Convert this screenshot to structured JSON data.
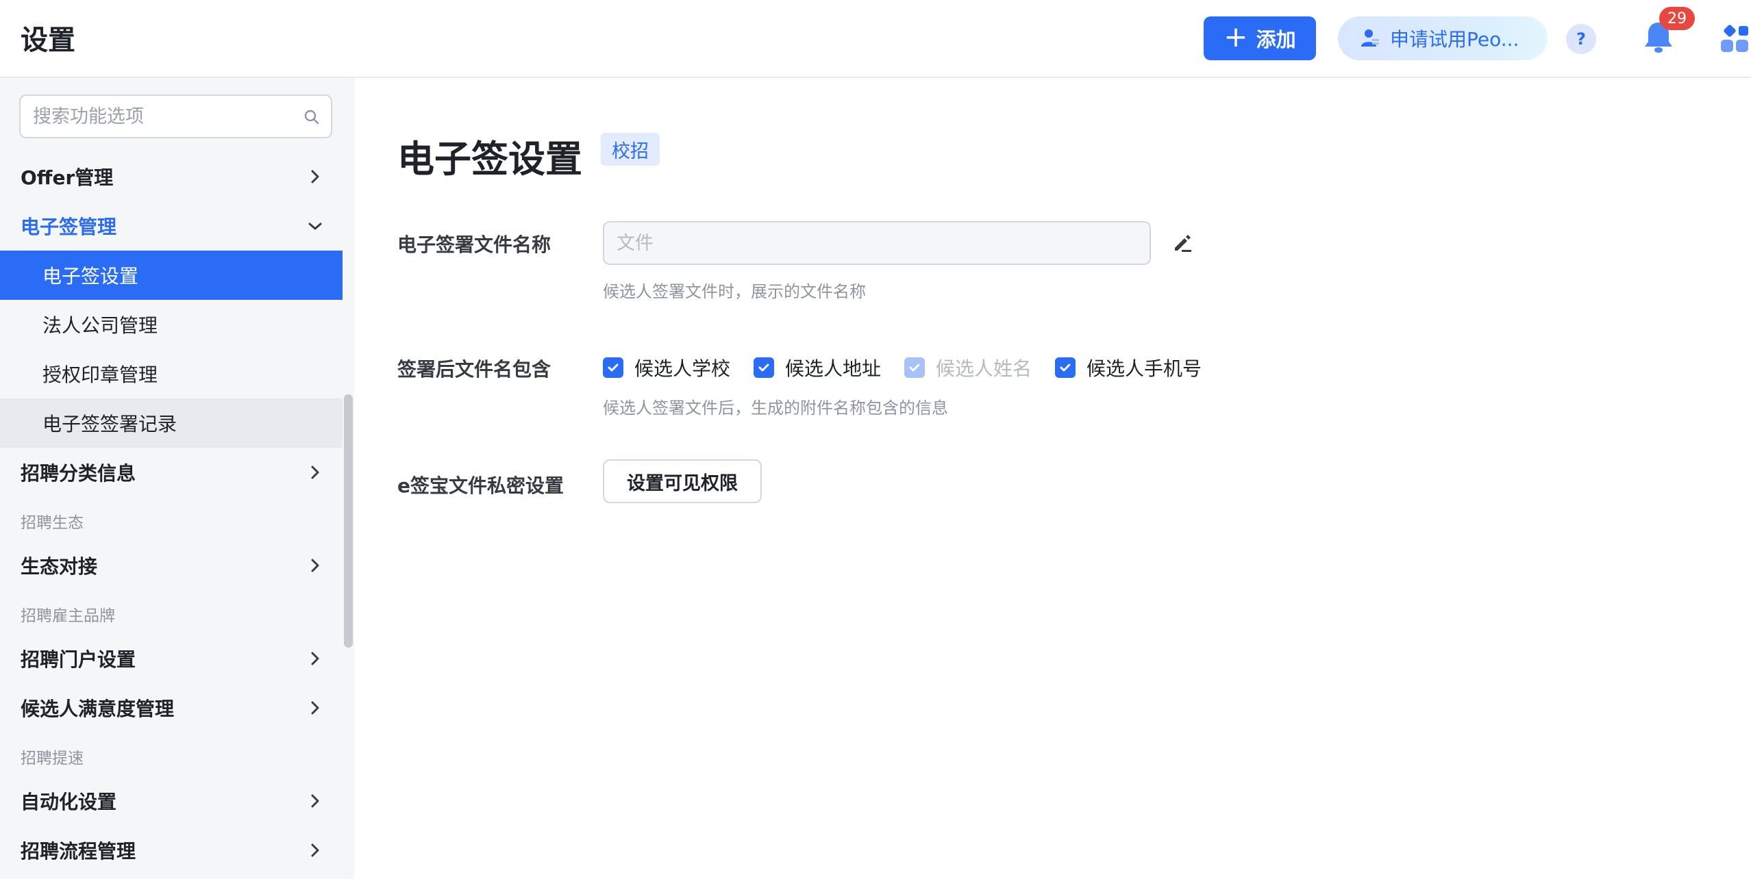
{
  "header": {
    "title": "设置",
    "add_label": "添加",
    "trial_label": "申请试用Peo...",
    "help_label": "?",
    "notification_count": "29"
  },
  "sidebar": {
    "search_placeholder": "搜索功能选项",
    "items": {
      "offer": "Offer管理",
      "esign": "电子签管理",
      "esign_settings": "电子签设置",
      "legal_company": "法人公司管理",
      "seal": "授权印章管理",
      "sign_records": "电子签签署记录",
      "category": "招聘分类信息",
      "group_ecosystem": "招聘生态",
      "ecosystem": "生态对接",
      "group_brand": "招聘雇主品牌",
      "portal": "招聘门户设置",
      "satisfaction": "候选人满意度管理",
      "group_speed": "招聘提速",
      "automation": "自动化设置",
      "process": "招聘流程管理"
    }
  },
  "main": {
    "title": "电子签设置",
    "tag": "校招",
    "file_name": {
      "label": "电子签署文件名称",
      "value": "",
      "placeholder": "文件",
      "hint": "候选人签署文件时，展示的文件名称"
    },
    "include": {
      "label": "签署后文件名包含",
      "options": [
        {
          "label": "候选人学校",
          "checked": true,
          "disabled": false
        },
        {
          "label": "候选人地址",
          "checked": true,
          "disabled": false
        },
        {
          "label": "候选人姓名",
          "checked": true,
          "disabled": true
        },
        {
          "label": "候选人手机号",
          "checked": true,
          "disabled": false
        }
      ],
      "hint": "候选人签署文件后，生成的附件名称包含的信息"
    },
    "privacy": {
      "label": "e签宝文件私密设置",
      "button": "设置可见权限"
    }
  },
  "colors": {
    "primary": "#2a6cf6",
    "badge": "#e5483e",
    "sidebar_bg": "#f5f6f8"
  }
}
